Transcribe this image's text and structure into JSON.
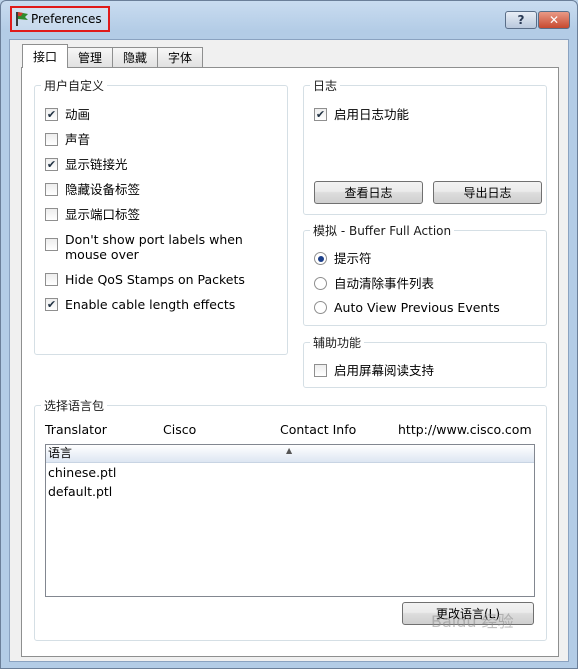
{
  "window": {
    "title": "Preferences",
    "help_label": "?",
    "close_label": "✕"
  },
  "tabs": [
    {
      "label": "接口",
      "active": true
    },
    {
      "label": "管理",
      "active": false
    },
    {
      "label": "隐藏",
      "active": false
    },
    {
      "label": "字体",
      "active": false
    }
  ],
  "custom": {
    "title": "用户自定义",
    "items": [
      {
        "label": "动画",
        "checked": true
      },
      {
        "label": "声音",
        "checked": false
      },
      {
        "label": "显示链接光",
        "checked": true
      },
      {
        "label": "隐藏设备标签",
        "checked": false
      },
      {
        "label": "显示端口标签",
        "checked": false
      },
      {
        "label": "Don't show port labels when mouse over",
        "checked": false
      },
      {
        "label": "Hide QoS Stamps on Packets",
        "checked": false
      },
      {
        "label": "Enable cable length effects",
        "checked": true
      }
    ]
  },
  "log": {
    "title": "日志",
    "enable_label": "启用日志功能",
    "enable_checked": true,
    "view_button": "查看日志",
    "export_button": "导出日志"
  },
  "sim": {
    "title": "模拟 - Buffer Full Action",
    "options": [
      {
        "label": "提示符",
        "selected": true
      },
      {
        "label": "自动清除事件列表",
        "selected": false
      },
      {
        "label": "Auto View Previous Events",
        "selected": false
      }
    ]
  },
  "access": {
    "title": "辅助功能",
    "screen_reader_label": "启用屏幕阅读支持",
    "checked": false
  },
  "lang": {
    "title": "选择语言包",
    "translator_label": "Translator",
    "translator_value": "Cisco",
    "contact_label": "Contact Info",
    "contact_value": "http://www.cisco.com",
    "list_header": "语言",
    "items": [
      "chinese.ptl",
      "default.ptl"
    ],
    "change_button": "更改语言(L)"
  },
  "watermark": "Baidu 经验",
  "icons": {
    "checkmark": "✔",
    "sort_up": "▲"
  }
}
